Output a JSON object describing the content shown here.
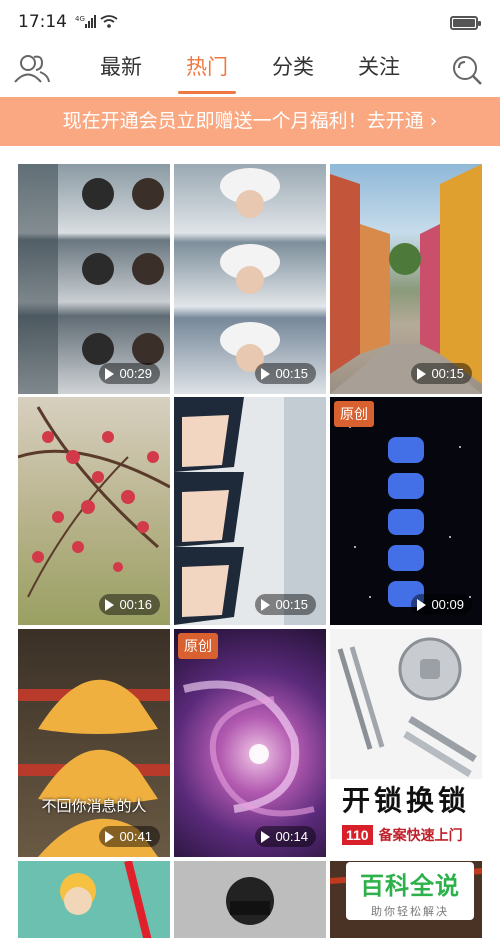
{
  "status": {
    "time": "17:14",
    "network": "4G"
  },
  "nav": {
    "tabs": [
      {
        "label": "最新",
        "active": false
      },
      {
        "label": "热门",
        "active": true
      },
      {
        "label": "分类",
        "active": false
      },
      {
        "label": "关注",
        "active": false
      }
    ],
    "accent_color": "#f07840"
  },
  "banner": {
    "text": "现在开通会员立即赠送一个月福利！去开通"
  },
  "tiles": [
    {
      "duration": "00:29",
      "badge": ""
    },
    {
      "duration": "00:15",
      "badge": ""
    },
    {
      "duration": "00:15",
      "badge": ""
    },
    {
      "duration": "00:16",
      "badge": ""
    },
    {
      "duration": "00:15",
      "badge": ""
    },
    {
      "duration": "00:09",
      "badge": "原创"
    },
    {
      "duration": "00:41",
      "badge": "",
      "caption": "不回你消息的人"
    },
    {
      "duration": "00:14",
      "badge": "原创"
    },
    {
      "duration": "",
      "badge": "",
      "ad_title": "开锁换锁",
      "ad_phone": "110",
      "ad_line": "备案快速上门"
    },
    {
      "duration": "",
      "badge": ""
    },
    {
      "duration": "",
      "badge": ""
    },
    {
      "duration": "",
      "badge": ""
    }
  ],
  "watermark": {
    "title": "百科全说",
    "subtitle": "助你轻松解决"
  }
}
